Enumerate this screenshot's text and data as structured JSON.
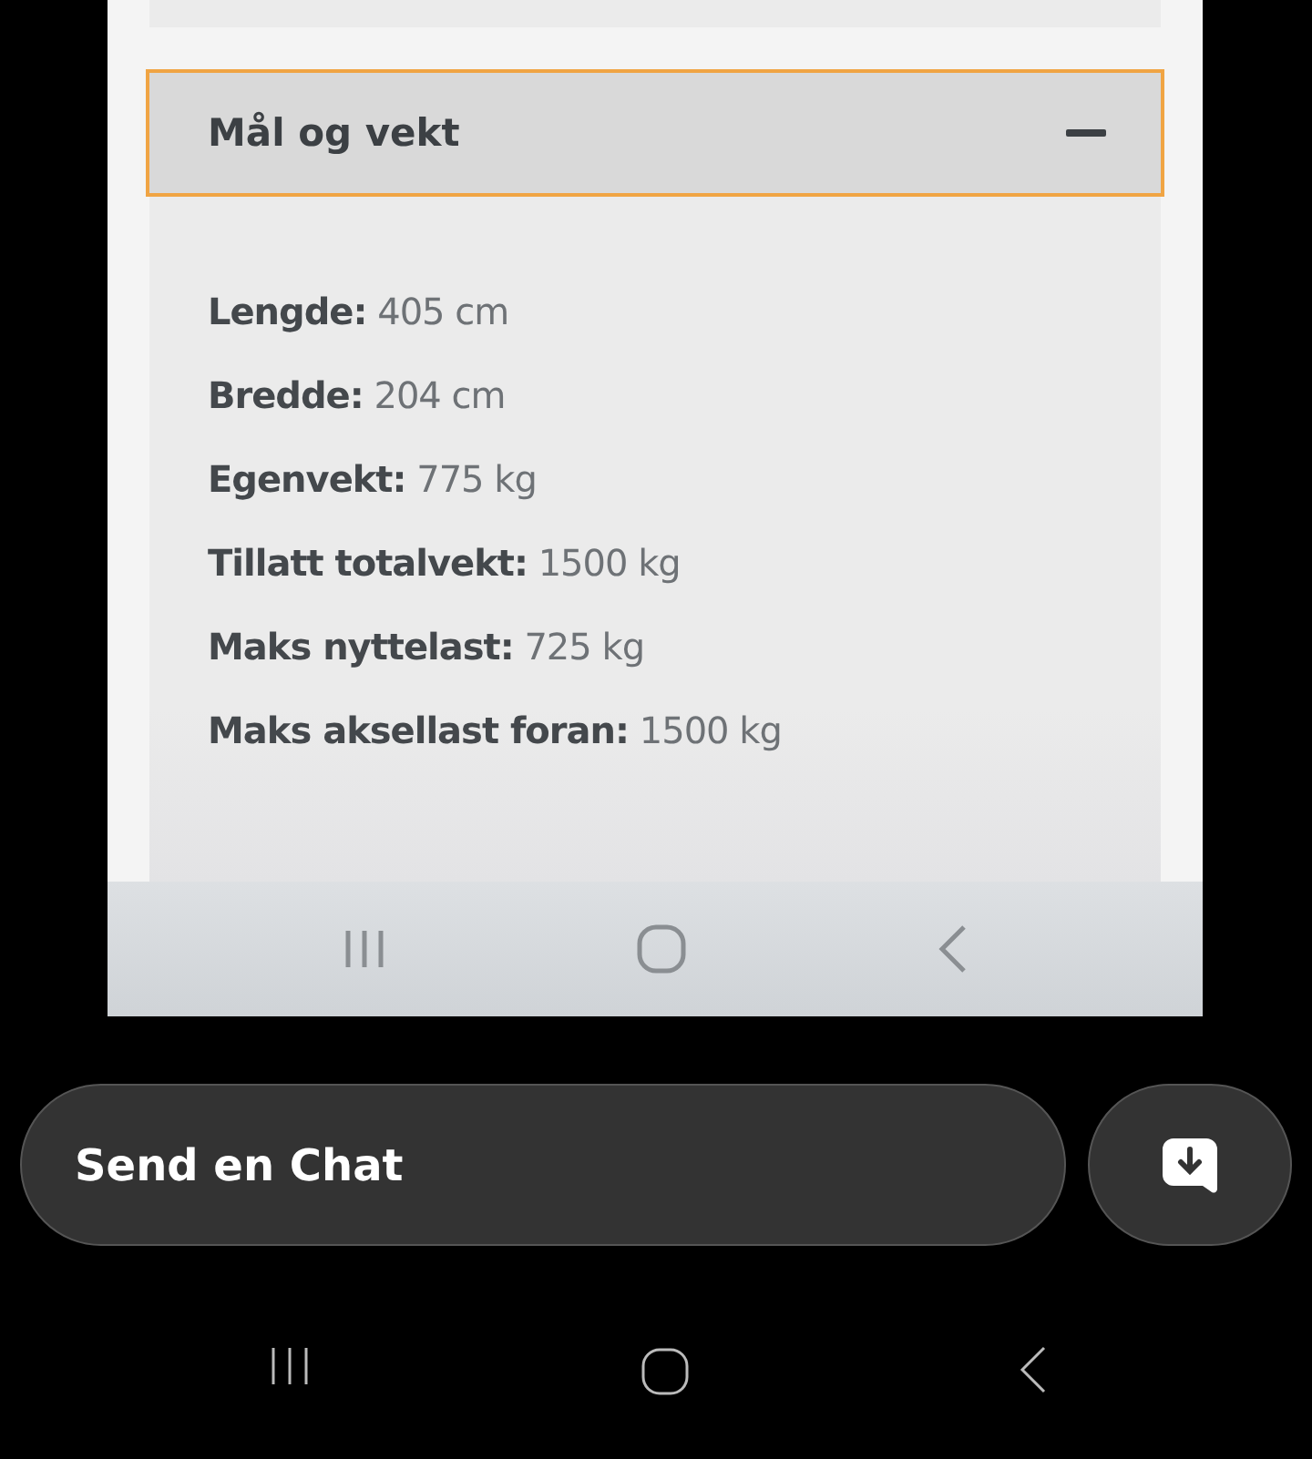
{
  "screenshot": {
    "section": {
      "title": "Mål og vekt",
      "expanded": true,
      "specs": [
        {
          "label": "Lengde:",
          "value": "405 cm"
        },
        {
          "label": "Bredde:",
          "value": "204 cm"
        },
        {
          "label": "Egenvekt:",
          "value": "775 kg"
        },
        {
          "label": "Tillatt totalvekt:",
          "value": "1500 kg"
        },
        {
          "label": "Maks nyttelast:",
          "value": "725 kg"
        },
        {
          "label": "Maks aksellast foran:",
          "value": "1500 kg"
        }
      ]
    }
  },
  "chat": {
    "placeholder": "Send en Chat"
  }
}
